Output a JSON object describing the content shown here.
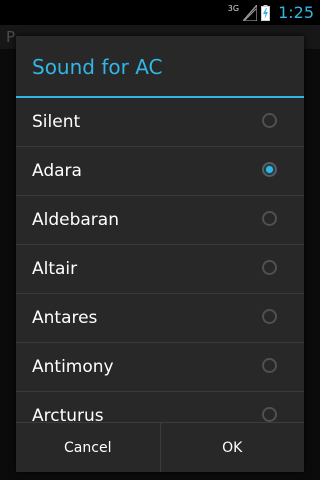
{
  "status_bar": {
    "network": "3G",
    "time": "1:25",
    "icons": [
      "signal-icon",
      "battery-charging-icon"
    ]
  },
  "background_app": {
    "title": "P"
  },
  "dialog": {
    "title": "Sound for AC",
    "accent_color": "#33b5e5",
    "selected": "Adara",
    "items": [
      {
        "label": "Silent",
        "checked": false
      },
      {
        "label": "Adara",
        "checked": true
      },
      {
        "label": "Aldebaran",
        "checked": false
      },
      {
        "label": "Altair",
        "checked": false
      },
      {
        "label": "Antares",
        "checked": false
      },
      {
        "label": "Antimony",
        "checked": false
      },
      {
        "label": "Arcturus",
        "checked": false
      }
    ],
    "buttons": {
      "cancel": "Cancel",
      "ok": "OK"
    }
  }
}
